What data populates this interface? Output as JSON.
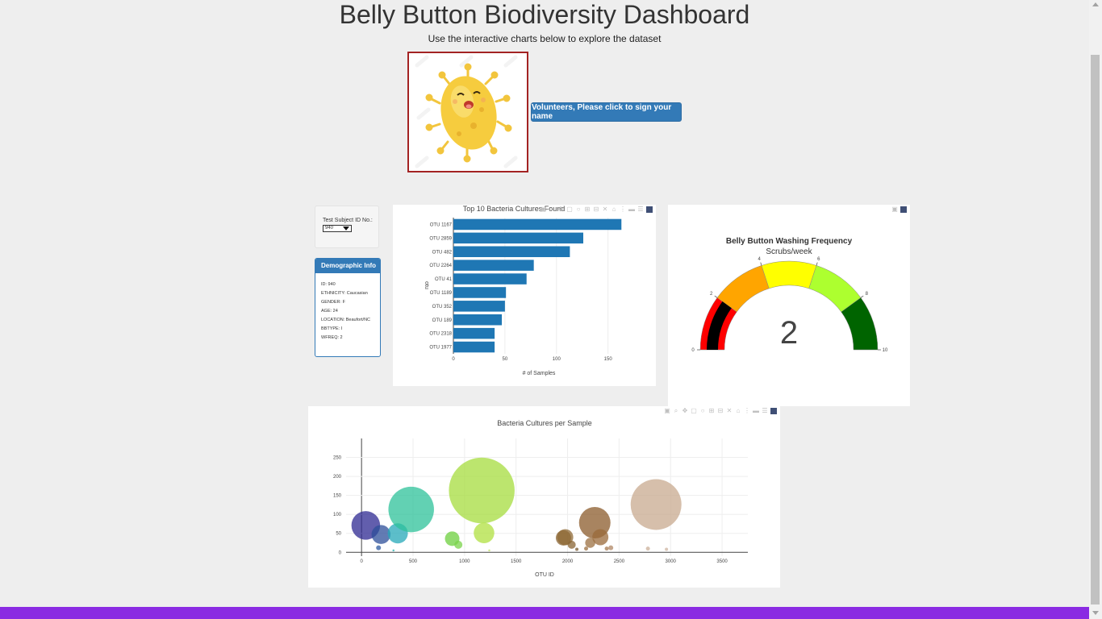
{
  "header": {
    "title": "Belly Button Biodiversity Dashboard",
    "subtitle": "Use the interactive charts below to explore the dataset"
  },
  "volunteer_button": {
    "label": "Volunteers, Please click to sign your name"
  },
  "selector": {
    "label": "Test Subject ID No.:",
    "value": "940"
  },
  "demographics": {
    "title": "Demographic Info",
    "lines": [
      "ID: 940",
      "ETHNICITY: Caucasian",
      "GENDER: F",
      "AGE: 24",
      "LOCATION: Beaufort/NC",
      "BBTYPE: I",
      "WFREQ: 2"
    ]
  },
  "colors": {
    "bar": "#1f77b4",
    "brand": "#337ab7",
    "footer": "#8a2be2",
    "mascot_border": "#a32323"
  },
  "icons": [
    "camera-icon",
    "zoom-icon",
    "pan-icon",
    "box-select-icon",
    "lasso-icon",
    "zoom-in-icon",
    "zoom-out-icon",
    "autoscale-icon",
    "reset-axes-icon",
    "spike-lines-icon",
    "hover-closest-icon",
    "hover-compare-icon",
    "plotly-logo-icon"
  ],
  "chart_data": [
    {
      "type": "bar",
      "orientation": "h",
      "title": "Top 10 Bacteria Cultures Found",
      "xlabel": "# of Samples",
      "ylabel": "otu",
      "categories": [
        "OTU 1167",
        "OTU 2859",
        "OTU 482",
        "OTU 2264",
        "OTU 41",
        "OTU 1189",
        "OTU 352",
        "OTU 189",
        "OTU 2318",
        "OTU 1977"
      ],
      "values": [
        163,
        126,
        113,
        78,
        71,
        51,
        50,
        47,
        40,
        40
      ],
      "xlim": [
        0,
        180
      ],
      "xticks": [
        "0",
        "50",
        "100",
        "150"
      ]
    },
    {
      "type": "gauge",
      "title": "Belly Button Washing Frequency",
      "subtitle": "Scrubs/week",
      "value": 2,
      "range": [
        0,
        10
      ],
      "ticks": [
        "0",
        "2",
        "4",
        "6",
        "8",
        "10"
      ],
      "steps": [
        {
          "range": [
            0,
            2
          ],
          "color": "#ff0000"
        },
        {
          "range": [
            2,
            4
          ],
          "color": "#ffa500"
        },
        {
          "range": [
            4,
            6
          ],
          "color": "#ffff00"
        },
        {
          "range": [
            6,
            8
          ],
          "color": "#adff2f"
        },
        {
          "range": [
            8,
            10
          ],
          "color": "#006400"
        }
      ],
      "bar_color": "#000000"
    },
    {
      "type": "scatter",
      "mode": "bubble",
      "title": "Bacteria Cultures per Sample",
      "xlabel": "OTU ID",
      "xlim": [
        -150,
        3750
      ],
      "ylim": [
        -10,
        300
      ],
      "xticks": [
        0,
        500,
        1000,
        1500,
        2000,
        2500,
        3000,
        3500
      ],
      "yticks": [
        0,
        50,
        100,
        150,
        200,
        250
      ],
      "points": [
        {
          "x": 41,
          "y": 71,
          "size": 71,
          "color": "#2e2891"
        },
        {
          "x": 189,
          "y": 47,
          "size": 47,
          "color": "#2d4f99"
        },
        {
          "x": 165,
          "y": 12,
          "size": 12,
          "color": "#2e5aa0"
        },
        {
          "x": 352,
          "y": 50,
          "size": 50,
          "color": "#25a8b8"
        },
        {
          "x": 482,
          "y": 113,
          "size": 113,
          "color": "#2dc29a"
        },
        {
          "x": 310,
          "y": 5,
          "size": 5,
          "color": "#27b0b0"
        },
        {
          "x": 880,
          "y": 36,
          "size": 36,
          "color": "#6ccf3e"
        },
        {
          "x": 940,
          "y": 20,
          "size": 20,
          "color": "#7ad34a"
        },
        {
          "x": 1167,
          "y": 163,
          "size": 163,
          "color": "#a6dc3d"
        },
        {
          "x": 1189,
          "y": 51,
          "size": 51,
          "color": "#b0e040"
        },
        {
          "x": 1240,
          "y": 5,
          "size": 5,
          "color": "#c3e360"
        },
        {
          "x": 1960,
          "y": 38,
          "size": 38,
          "color": "#8a6433"
        },
        {
          "x": 1977,
          "y": 40,
          "size": 40,
          "color": "#8f6a35"
        },
        {
          "x": 2040,
          "y": 20,
          "size": 20,
          "color": "#8a6433"
        },
        {
          "x": 2090,
          "y": 8,
          "size": 8,
          "color": "#7a5a30"
        },
        {
          "x": 2264,
          "y": 78,
          "size": 78,
          "color": "#8b5b2b"
        },
        {
          "x": 2318,
          "y": 40,
          "size": 40,
          "color": "#9a6a3a"
        },
        {
          "x": 2220,
          "y": 25,
          "size": 25,
          "color": "#9c7042"
        },
        {
          "x": 2180,
          "y": 10,
          "size": 10,
          "color": "#9c7042"
        },
        {
          "x": 2380,
          "y": 10,
          "size": 10,
          "color": "#a67a50"
        },
        {
          "x": 2420,
          "y": 12,
          "size": 12,
          "color": "#b08766"
        },
        {
          "x": 2780,
          "y": 10,
          "size": 10,
          "color": "#cbb09a"
        },
        {
          "x": 2859,
          "y": 126,
          "size": 126,
          "color": "#c8a98f"
        },
        {
          "x": 2960,
          "y": 8,
          "size": 8,
          "color": "#cdb4a0"
        }
      ]
    }
  ]
}
